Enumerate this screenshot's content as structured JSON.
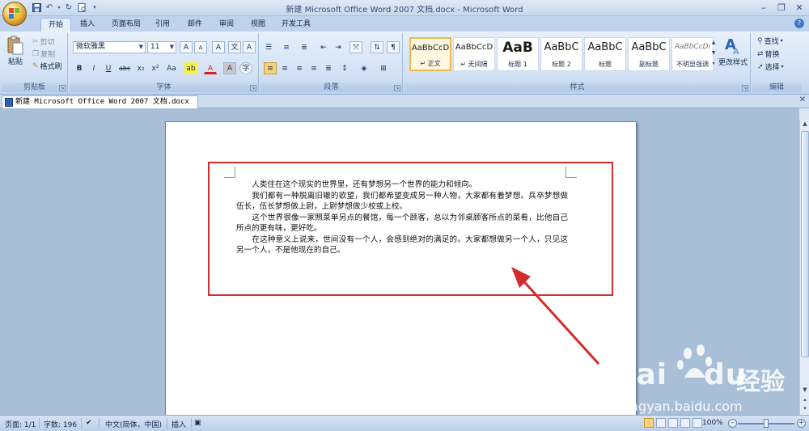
{
  "window": {
    "title": "新建 Microsoft Office Word 2007 文档.docx - Microsoft Word"
  },
  "quick_access": {
    "save_icon": "save-icon",
    "undo_icon": "undo-icon",
    "redo_icon": "redo-icon",
    "print_preview_icon": "print-preview-icon",
    "customize_icon": "customize-arrow-icon"
  },
  "ribbon_tabs": [
    "开始",
    "插入",
    "页面布局",
    "引用",
    "邮件",
    "审阅",
    "视图",
    "开发工具"
  ],
  "clipboard": {
    "paste": "粘贴",
    "cut": "剪切",
    "copy": "复制",
    "format_painter": "格式刷",
    "label": "剪贴板"
  },
  "font": {
    "name": "微软雅黑",
    "size": "11",
    "label": "字体",
    "bold": "B",
    "italic": "I",
    "underline": "U",
    "strike": "abc",
    "subscript": "x₂",
    "superscript": "x²",
    "change_case": "Aa",
    "grow": "A",
    "shrink": "A",
    "clear": "A",
    "font_color": "A",
    "char_border": "A",
    "phonetic": "文",
    "enclose": "字"
  },
  "paragraph": {
    "label": "段落"
  },
  "styles": {
    "label": "样式",
    "items": [
      {
        "sample": "AaBbCcD",
        "name": "↵ 正文",
        "selected": true
      },
      {
        "sample": "AaBbCcD",
        "name": "↵ 无间隔",
        "selected": false
      },
      {
        "sample": "AaB",
        "name": "标题 1",
        "selected": false
      },
      {
        "sample": "AaBbC",
        "name": "标题 2",
        "selected": false
      },
      {
        "sample": "AaBbC",
        "name": "标题",
        "selected": false
      },
      {
        "sample": "AaBbC",
        "name": "副标题",
        "selected": false
      },
      {
        "sample": "AaBbCcDı",
        "name": "不明显强调",
        "selected": false
      }
    ],
    "change_styles": "更改样式"
  },
  "editing": {
    "label": "编辑",
    "find": "查找",
    "replace": "替换",
    "select": "选择"
  },
  "document_tab": "新建 Microsoft Office Word 2007 文档.docx *",
  "document": {
    "paragraphs": [
      "人类住在这个现实的世界里，还有梦想另一个世界的能力和倾向。",
      "我们都有一种脱离旧辙的欲望，我们都希望变成另一种人物，大家都有着梦想。兵卒梦想做伍长，伍长梦想做上尉，上尉梦想做少校或上校。",
      "这个世界很像一家照菜单另点的餐馆，每一个顾客，总以为邻桌顾客所点的菜肴，比他自己所点的更有味，更好吃。",
      "在这种意义上说来，世间没有一个人，会感到绝对的满足的。大家都想做另一个人，只见这另一个人，不是他现在的自己。"
    ]
  },
  "status": {
    "page": "页面: 1/1",
    "words": "字数: 196",
    "language": "中文(简体，中国)",
    "insert": "插入",
    "zoom": "100%"
  },
  "watermark": {
    "brand": "Bai",
    "brand_tail": "du",
    "brand_cn": "经验",
    "url": "jingyan.baidu.com"
  }
}
